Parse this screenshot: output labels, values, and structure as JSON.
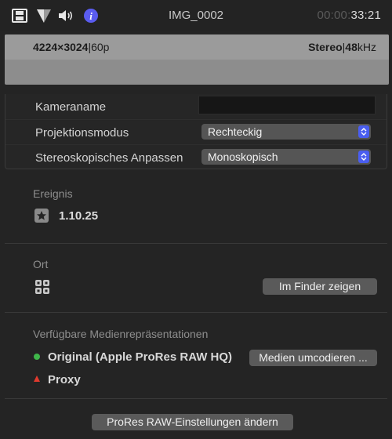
{
  "toolbar": {
    "title": "IMG_0002",
    "timecode_dim": "00:00:",
    "timecode_main": "33:21",
    "icons": [
      "film-icon",
      "filter-icon",
      "speaker-icon",
      "info-icon"
    ]
  },
  "info": {
    "resolution": "4224×3024",
    "framerate": "60p",
    "audio_channels": "Stereo",
    "sample_rate_value": "48",
    "sample_rate_unit": "kHz"
  },
  "settings": {
    "camera_name_label": "Kameraname",
    "camera_name_value": "",
    "projection_label": "Projektionsmodus",
    "projection_value": "Rechteckig",
    "stereo_label": "Stereoskopisches Anpassen",
    "stereo_value": "Monoskopisch"
  },
  "event": {
    "label": "Ereignis",
    "value": "1.10.25"
  },
  "location": {
    "label": "Ort",
    "finder_button": "Im Finder zeigen"
  },
  "media": {
    "label": "Verfügbare Medienrepräsentationen",
    "original": "Original (Apple ProRes RAW HQ)",
    "proxy": "Proxy",
    "transcode_button": "Medien umcodieren ...",
    "original_status_color": "#3fb64a",
    "proxy_status_color": "#e03a2e"
  },
  "footer": {
    "prores_button": "ProRes RAW-Einstellungen ändern"
  }
}
